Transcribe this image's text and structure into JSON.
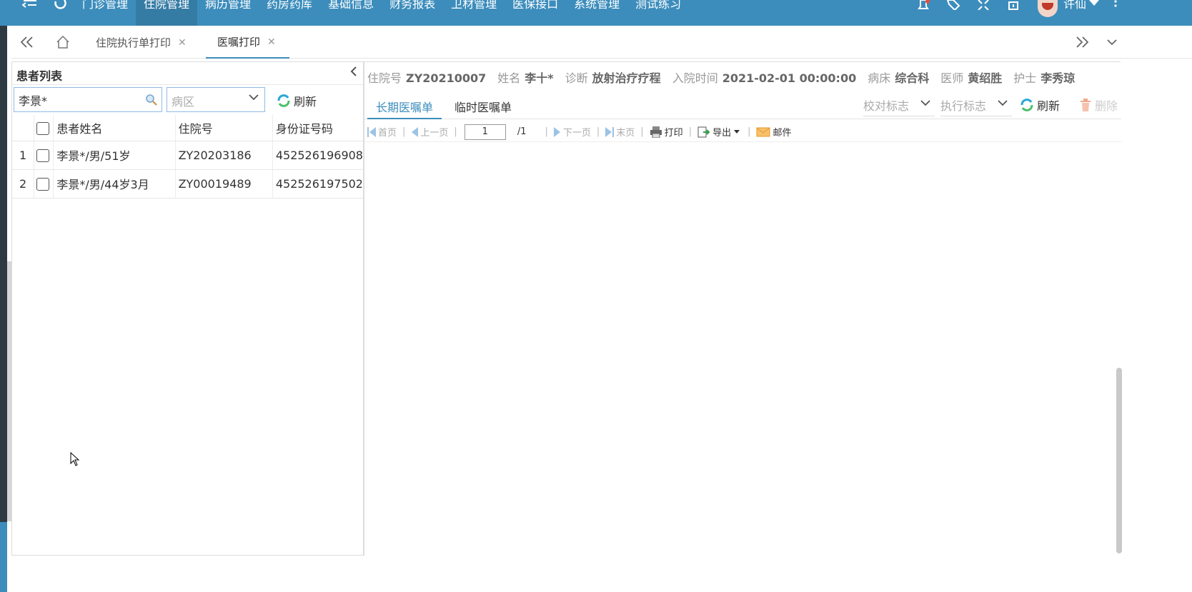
{
  "topnav": {
    "menu": [
      {
        "label": "门诊管理",
        "active": false
      },
      {
        "label": "住院管理",
        "active": true
      },
      {
        "label": "病历管理",
        "active": false
      },
      {
        "label": "药房药库",
        "active": false
      },
      {
        "label": "基础信息",
        "active": false
      },
      {
        "label": "财务报表",
        "active": false
      },
      {
        "label": "卫材管理",
        "active": false
      },
      {
        "label": "医保接口",
        "active": false
      },
      {
        "label": "系统管理",
        "active": false
      },
      {
        "label": "测试练习",
        "active": false
      }
    ],
    "user_name": "许仙",
    "accent": "#3c8dbc"
  },
  "tabs": [
    {
      "label": "住院执行单打印",
      "active": false
    },
    {
      "label": "医嘱打印",
      "active": true
    }
  ],
  "patient_list": {
    "title": "患者列表",
    "search_value": "李景*",
    "ward_placeholder": "病区",
    "refresh_label": "刷新",
    "columns": [
      "患者姓名",
      "住院号",
      "身份证号码"
    ],
    "rows": [
      {
        "no": "1",
        "name": "李景*/男/51岁",
        "id": "ZY20203186",
        "card": "452526196908"
      },
      {
        "no": "2",
        "name": "李景*/男/44岁3月",
        "id": "ZY00019489",
        "card": "452526197502"
      }
    ]
  },
  "patient_info": {
    "admission_no_label": "住院号",
    "admission_no": "ZY20210007",
    "name_label": "姓名",
    "name": "李十*",
    "diagnosis_label": "诊断",
    "diagnosis": "放射治疗疗程",
    "admit_time_label": "入院时间",
    "admit_time": "2021-02-01 00:00:00",
    "bed_label": "病床",
    "bed": "综合科",
    "doctor_label": "医师",
    "doctor": "黄绍胜",
    "nurse_label": "护士",
    "nurse": "李秀琼"
  },
  "order_tabs": [
    "长期医嘱单",
    "临时医嘱单"
  ],
  "filters": {
    "check_flag": "校对标志",
    "exec_flag": "执行标志"
  },
  "actions": {
    "refresh": "刷新",
    "delete": "删除"
  },
  "pager": {
    "first": "首页",
    "prev": "上一页",
    "page": "1",
    "total": "/1",
    "next": "下一页",
    "last": "末页",
    "print": "打印",
    "export": "导出",
    "mail": "邮件"
  }
}
